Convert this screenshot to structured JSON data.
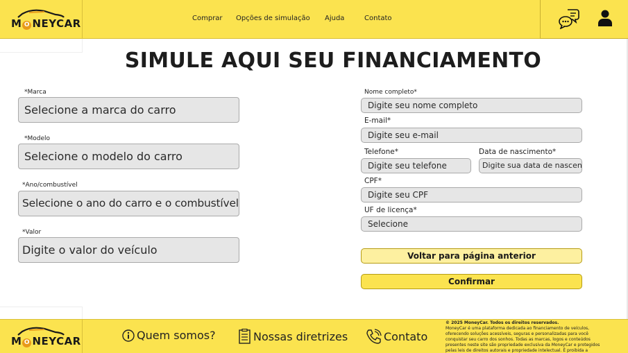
{
  "brand": {
    "logo_text": "M",
    "logo_coin": "O",
    "logo_rest": "NEYCAR"
  },
  "colors": {
    "primary": "#fbe34f",
    "secondary": "#fdf0a0",
    "field_bg": "#e6e6e6"
  },
  "nav": {
    "items": [
      {
        "label": "Comprar"
      },
      {
        "label": "Opções de simulação"
      },
      {
        "label": "Ajuda"
      },
      {
        "label": "Contato"
      }
    ],
    "icons": [
      "chat-icon",
      "user-icon"
    ]
  },
  "page": {
    "title": "SIMULE AQUI SEU FINANCIAMENTO"
  },
  "vehicle_form": {
    "marca": {
      "label": "*Marca",
      "placeholder": "Selecione a marca do carro"
    },
    "modelo": {
      "label": "*Modelo",
      "placeholder": "Selecione o modelo do carro"
    },
    "ano": {
      "label": "*Ano/combustível",
      "placeholder": "Selecione o ano do carro e o combustível"
    },
    "valor": {
      "label": "*Valor",
      "placeholder": "Digite o valor do veículo"
    }
  },
  "personal_form": {
    "nome": {
      "label": "Nome completo*",
      "placeholder": "Digite seu nome completo"
    },
    "email": {
      "label": "E-mail*",
      "placeholder": "Digite seu e-mail"
    },
    "telefone": {
      "label": "Telefone*",
      "placeholder": "Digite seu telefone"
    },
    "nascimento": {
      "label": "Data de nascimento*",
      "placeholder": "Digite sua data de nascença"
    },
    "cpf": {
      "label": "CPF*",
      "placeholder": "Digite seu CPF"
    },
    "uf": {
      "label": "UF de licença*",
      "value": "Selecione"
    }
  },
  "buttons": {
    "back": "Voltar para página anterior",
    "confirm": "Confirmar"
  },
  "footer": {
    "links": [
      {
        "label": "Quem somos?",
        "icon": "info-icon"
      },
      {
        "label": "Nossas diretrizes",
        "icon": "document-icon"
      },
      {
        "label": "Contato",
        "icon": "phone-icon"
      }
    ],
    "copyright_title": "© 2025 MoneyCar. Todos os direitos reservados.",
    "copyright_text": "MoneyCar é uma plataforma dedicada ao financiamento de veículos, oferecendo soluções acessíveis, seguras e personalizadas para você conquistar seu carro dos sonhos. Todas as marcas, logos e conteúdos presentes neste site são propriedade exclusiva da MoneyCar e protegidos pelas leis de direitos autorais e propriedade intelectual. É proibida a reprodução total ou parcial sem autorização prévia."
  }
}
